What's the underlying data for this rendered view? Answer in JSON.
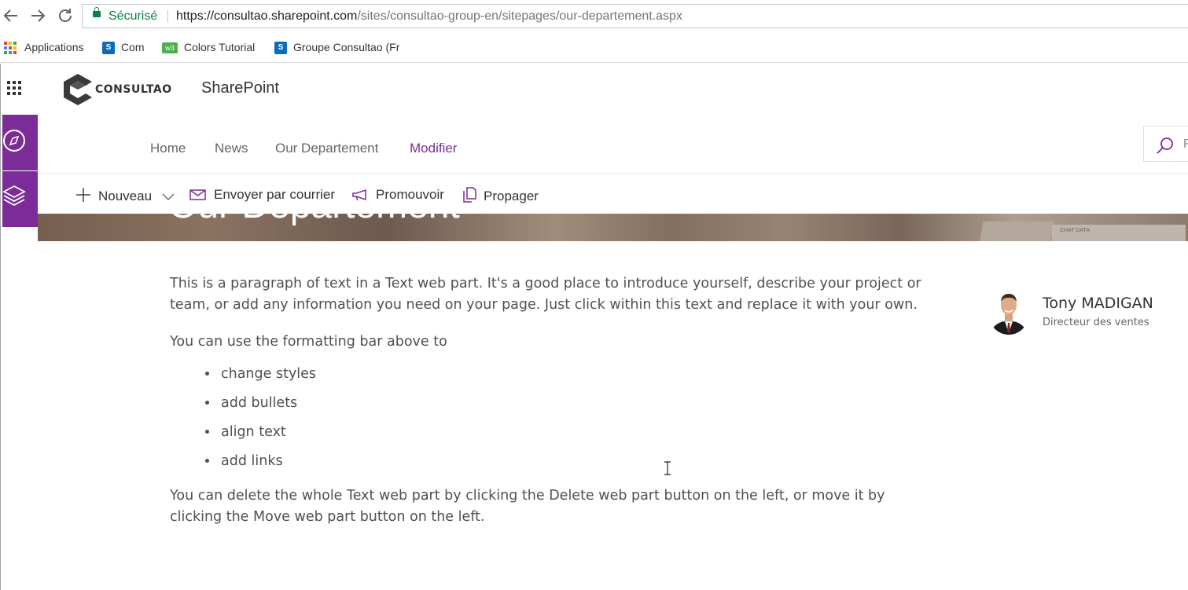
{
  "browser": {
    "secure_label": "Sécurisé",
    "url_host": "https://consultao.sharepoint.com",
    "url_path": "/sites/consultao-group-en/sitepages/our-departement.aspx",
    "bookmarks": [
      {
        "label": "Applications",
        "icon": "apps-grid-icon"
      },
      {
        "label": "Com",
        "icon": "sharepoint-icon"
      },
      {
        "label": "Colors Tutorial",
        "icon": "w3schools-icon"
      },
      {
        "label": "Groupe Consultao (Fr",
        "icon": "sharepoint-icon"
      }
    ]
  },
  "suite": {
    "logo_text": "CONSULTAO",
    "app_name": "SharePoint"
  },
  "nav": {
    "items": [
      {
        "label": "Home"
      },
      {
        "label": "News"
      },
      {
        "label": "Our Departement"
      },
      {
        "label": "Modifier"
      }
    ],
    "search_placeholder": "R"
  },
  "commands": {
    "new_label": "Nouveau",
    "email_label": "Envoyer par courrier",
    "promote_label": "Promouvoir",
    "propagate_label": "Propager"
  },
  "hero": {
    "title": "Our Departement",
    "photo_caption": "CHAT DATA"
  },
  "content": {
    "para1": "This is a paragraph of text in a Text web part. It's a good place to introduce yourself, describe your project or team, or add any information you need on your page. Just click within this text and replace it with your own.",
    "para2": "You can use the formatting bar above to",
    "bullets": [
      "change styles",
      "add bullets",
      "align text",
      "add links"
    ],
    "para3": "You can delete the whole Text web part by clicking the Delete web part button on the left, or move it by clicking the Move web part button on the left."
  },
  "profile": {
    "name": "Tony MADIGAN",
    "role": "Directeur des ventes"
  },
  "colors": {
    "accent": "#7b2c98",
    "secure_green": "#0b8043"
  }
}
